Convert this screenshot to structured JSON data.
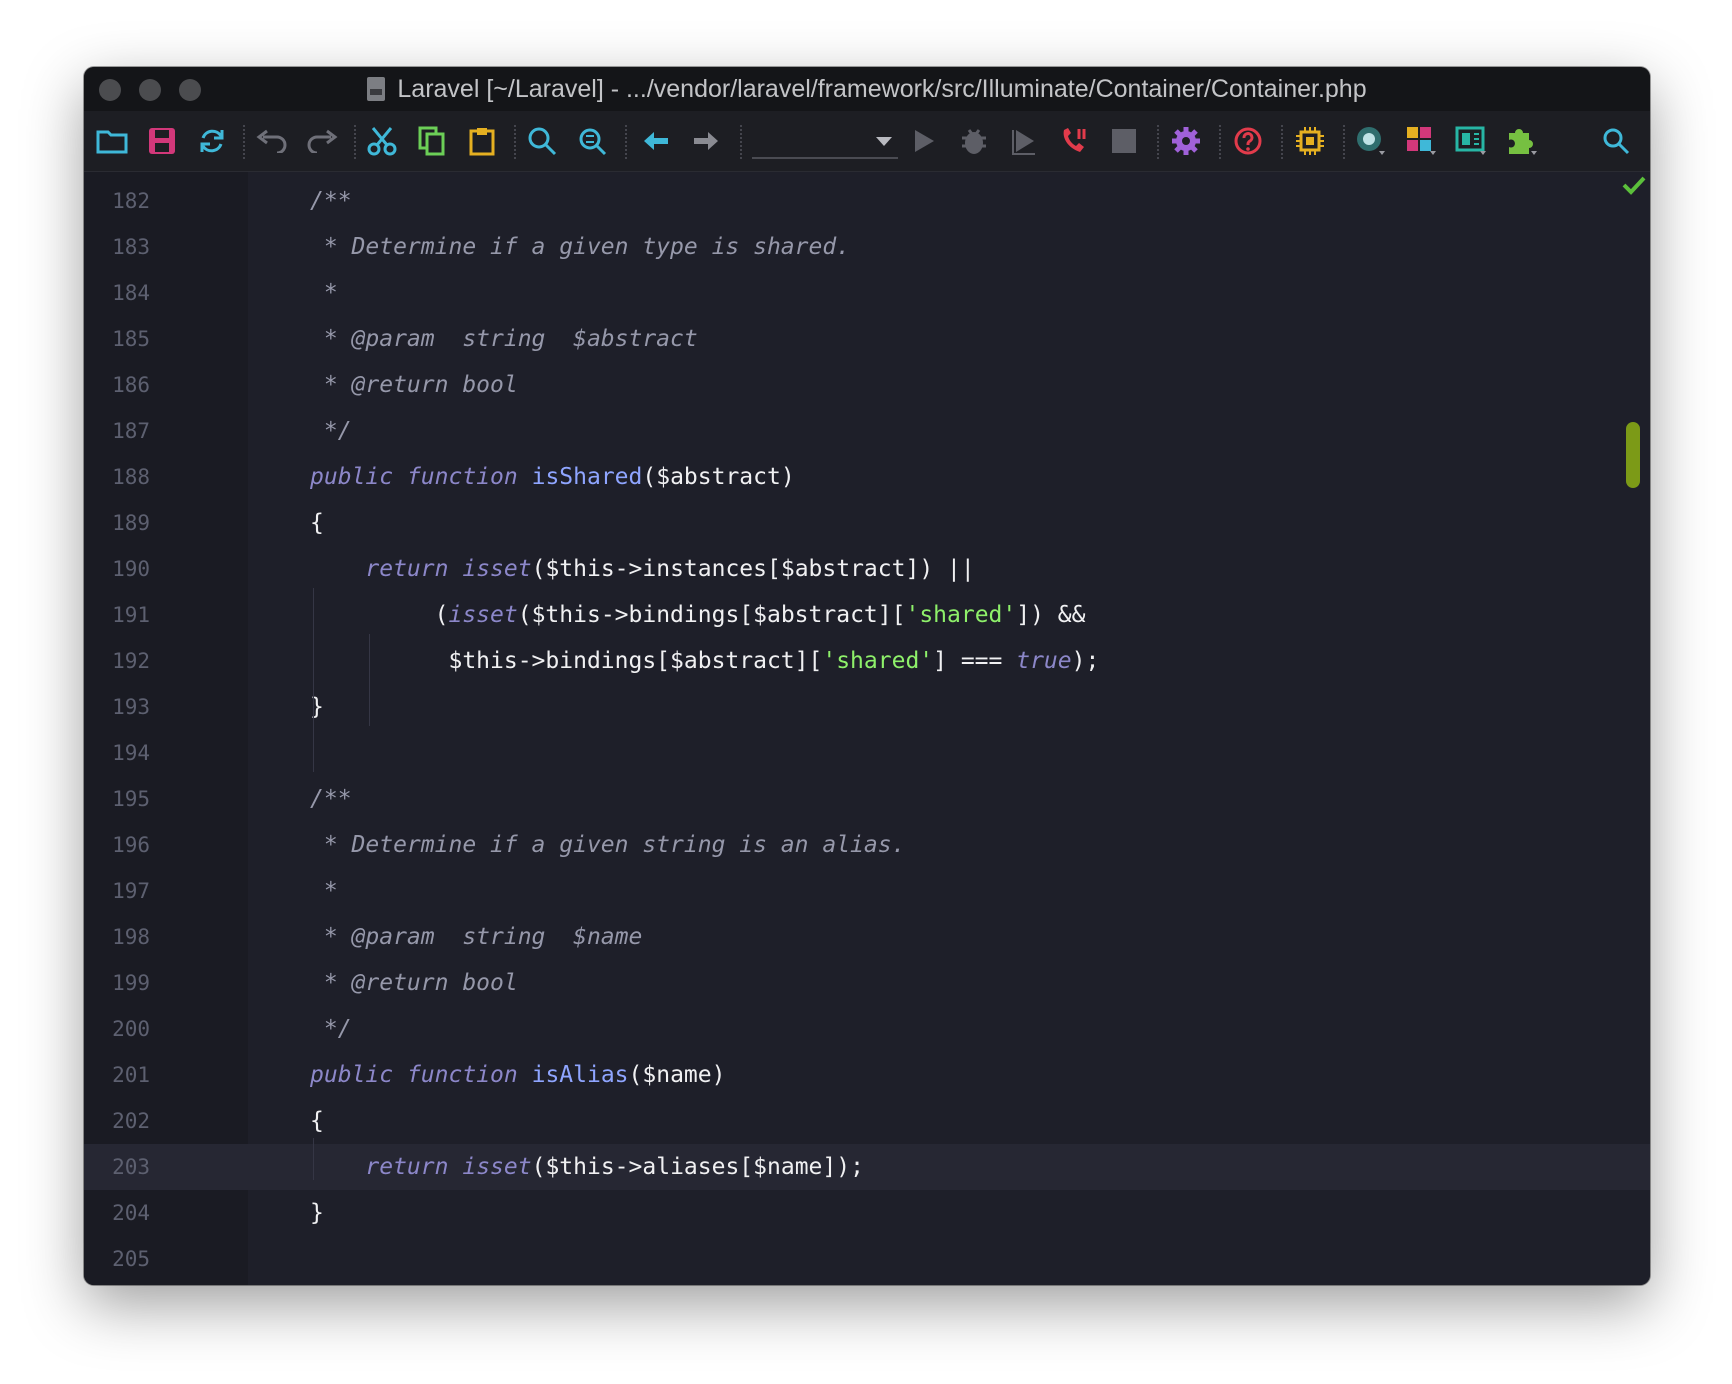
{
  "window": {
    "title": "Laravel [~/Laravel] - .../vendor/laravel/framework/src/Illuminate/Container/Container.php"
  },
  "toolbar": {
    "icons": [
      "open-folder-icon",
      "save-icon",
      "sync-icon",
      "undo-icon",
      "redo-icon",
      "cut-icon",
      "copy-icon",
      "paste-icon",
      "find-icon",
      "replace-icon",
      "back-icon",
      "forward-icon",
      "run-icon",
      "debug-icon",
      "step-icon",
      "listen-debug-icon",
      "stop-icon",
      "settings-icon",
      "help-icon",
      "plugin-chip-icon",
      "database-icon",
      "structure-icon",
      "layout-icon",
      "extension-icon",
      "search-everywhere-icon"
    ],
    "run_config": ""
  },
  "editor": {
    "lines": [
      {
        "n": "182",
        "segs": [
          [
            "c",
            "/**"
          ]
        ]
      },
      {
        "n": "183",
        "segs": [
          [
            "c",
            " * Determine if a given type is shared."
          ]
        ]
      },
      {
        "n": "184",
        "segs": [
          [
            "c",
            " *"
          ]
        ]
      },
      {
        "n": "185",
        "segs": [
          [
            "c",
            " * @param  string  $abstract"
          ]
        ]
      },
      {
        "n": "186",
        "segs": [
          [
            "c",
            " * @return bool"
          ]
        ]
      },
      {
        "n": "187",
        "segs": [
          [
            "c",
            " */"
          ]
        ]
      },
      {
        "n": "188",
        "segs": [
          [
            "kw",
            "public"
          ],
          [
            "pl",
            " "
          ],
          [
            "kw",
            "function"
          ],
          [
            "pl",
            " "
          ],
          [
            "fn",
            "isShared"
          ],
          [
            "pl",
            "($abstract)"
          ]
        ]
      },
      {
        "n": "189",
        "segs": [
          [
            "pl",
            "{"
          ]
        ]
      },
      {
        "n": "190",
        "segs": [
          [
            "pl",
            "    "
          ],
          [
            "kw",
            "return"
          ],
          [
            "pl",
            " "
          ],
          [
            "kw",
            "isset"
          ],
          [
            "pl",
            "($this->instances[$abstract]) ||"
          ]
        ]
      },
      {
        "n": "191",
        "segs": [
          [
            "pl",
            "         ("
          ],
          [
            "kw",
            "isset"
          ],
          [
            "pl",
            "($this->bindings[$abstract]["
          ],
          [
            "str",
            "'shared'"
          ],
          [
            "pl",
            "]) &&"
          ]
        ]
      },
      {
        "n": "192",
        "segs": [
          [
            "pl",
            "          $this->bindings[$abstract]["
          ],
          [
            "str",
            "'shared'"
          ],
          [
            "pl",
            "] === "
          ],
          [
            "kw",
            "true"
          ],
          [
            "pl",
            ");"
          ]
        ]
      },
      {
        "n": "193",
        "segs": [
          [
            "pl",
            "}"
          ]
        ]
      },
      {
        "n": "194",
        "segs": []
      },
      {
        "n": "195",
        "segs": [
          [
            "c",
            "/**"
          ]
        ]
      },
      {
        "n": "196",
        "segs": [
          [
            "c",
            " * Determine if a given string is an alias."
          ]
        ]
      },
      {
        "n": "197",
        "segs": [
          [
            "c",
            " *"
          ]
        ]
      },
      {
        "n": "198",
        "segs": [
          [
            "c",
            " * @param  string  $name"
          ]
        ]
      },
      {
        "n": "199",
        "segs": [
          [
            "c",
            " * @return bool"
          ]
        ]
      },
      {
        "n": "200",
        "segs": [
          [
            "c",
            " */"
          ]
        ]
      },
      {
        "n": "201",
        "segs": [
          [
            "kw",
            "public"
          ],
          [
            "pl",
            " "
          ],
          [
            "kw",
            "function"
          ],
          [
            "pl",
            " "
          ],
          [
            "fn",
            "isAlias"
          ],
          [
            "pl",
            "($name)"
          ]
        ]
      },
      {
        "n": "202",
        "segs": [
          [
            "pl",
            "{"
          ]
        ]
      },
      {
        "n": "203",
        "segs": [
          [
            "pl",
            "    "
          ],
          [
            "kw",
            "return"
          ],
          [
            "pl",
            " "
          ],
          [
            "kw",
            "isset"
          ],
          [
            "pl",
            "($this->aliases[$name]);"
          ]
        ],
        "current": true
      },
      {
        "n": "204",
        "segs": [
          [
            "pl",
            "}"
          ]
        ]
      },
      {
        "n": "205",
        "segs": []
      }
    ],
    "status": "no-problems-check"
  },
  "colors": {
    "background": "#1e1f29",
    "comment": "#9698aa",
    "keyword": "#8c87c9",
    "function": "#8fa5ff",
    "string": "#8ef06a",
    "scroll_marker": "#7c9a17"
  }
}
